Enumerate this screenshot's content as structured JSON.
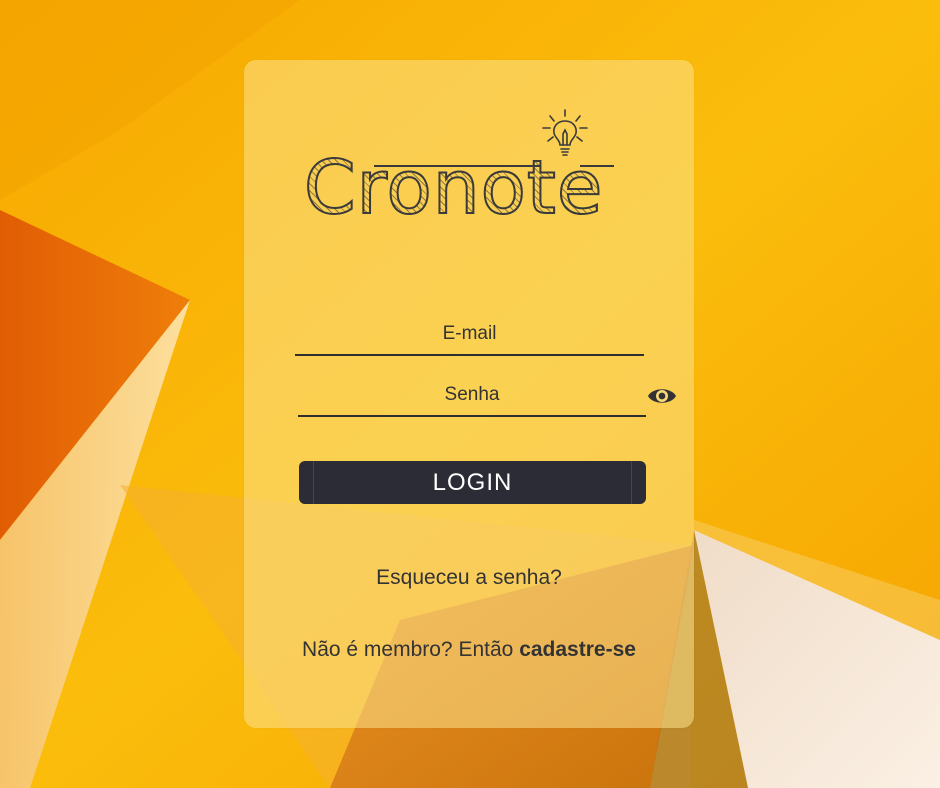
{
  "brand": {
    "logo_text": "Cronote"
  },
  "form": {
    "email_placeholder": "E-mail",
    "password_placeholder": "Senha",
    "login_label": "LOGIN"
  },
  "links": {
    "forgot_password": "Esqueceu a senha?",
    "signup_prompt": "Não é membro? Então",
    "signup_link": "cadastre-se"
  },
  "icons": {
    "password_toggle": "eye-icon",
    "logo_bulb": "lightbulb-icon"
  },
  "colors": {
    "background_primary": "#f7b500",
    "background_orange": "#e46d0c",
    "card_tint": "#fce28c",
    "button_bg": "#2b2c36",
    "text": "#333333"
  }
}
